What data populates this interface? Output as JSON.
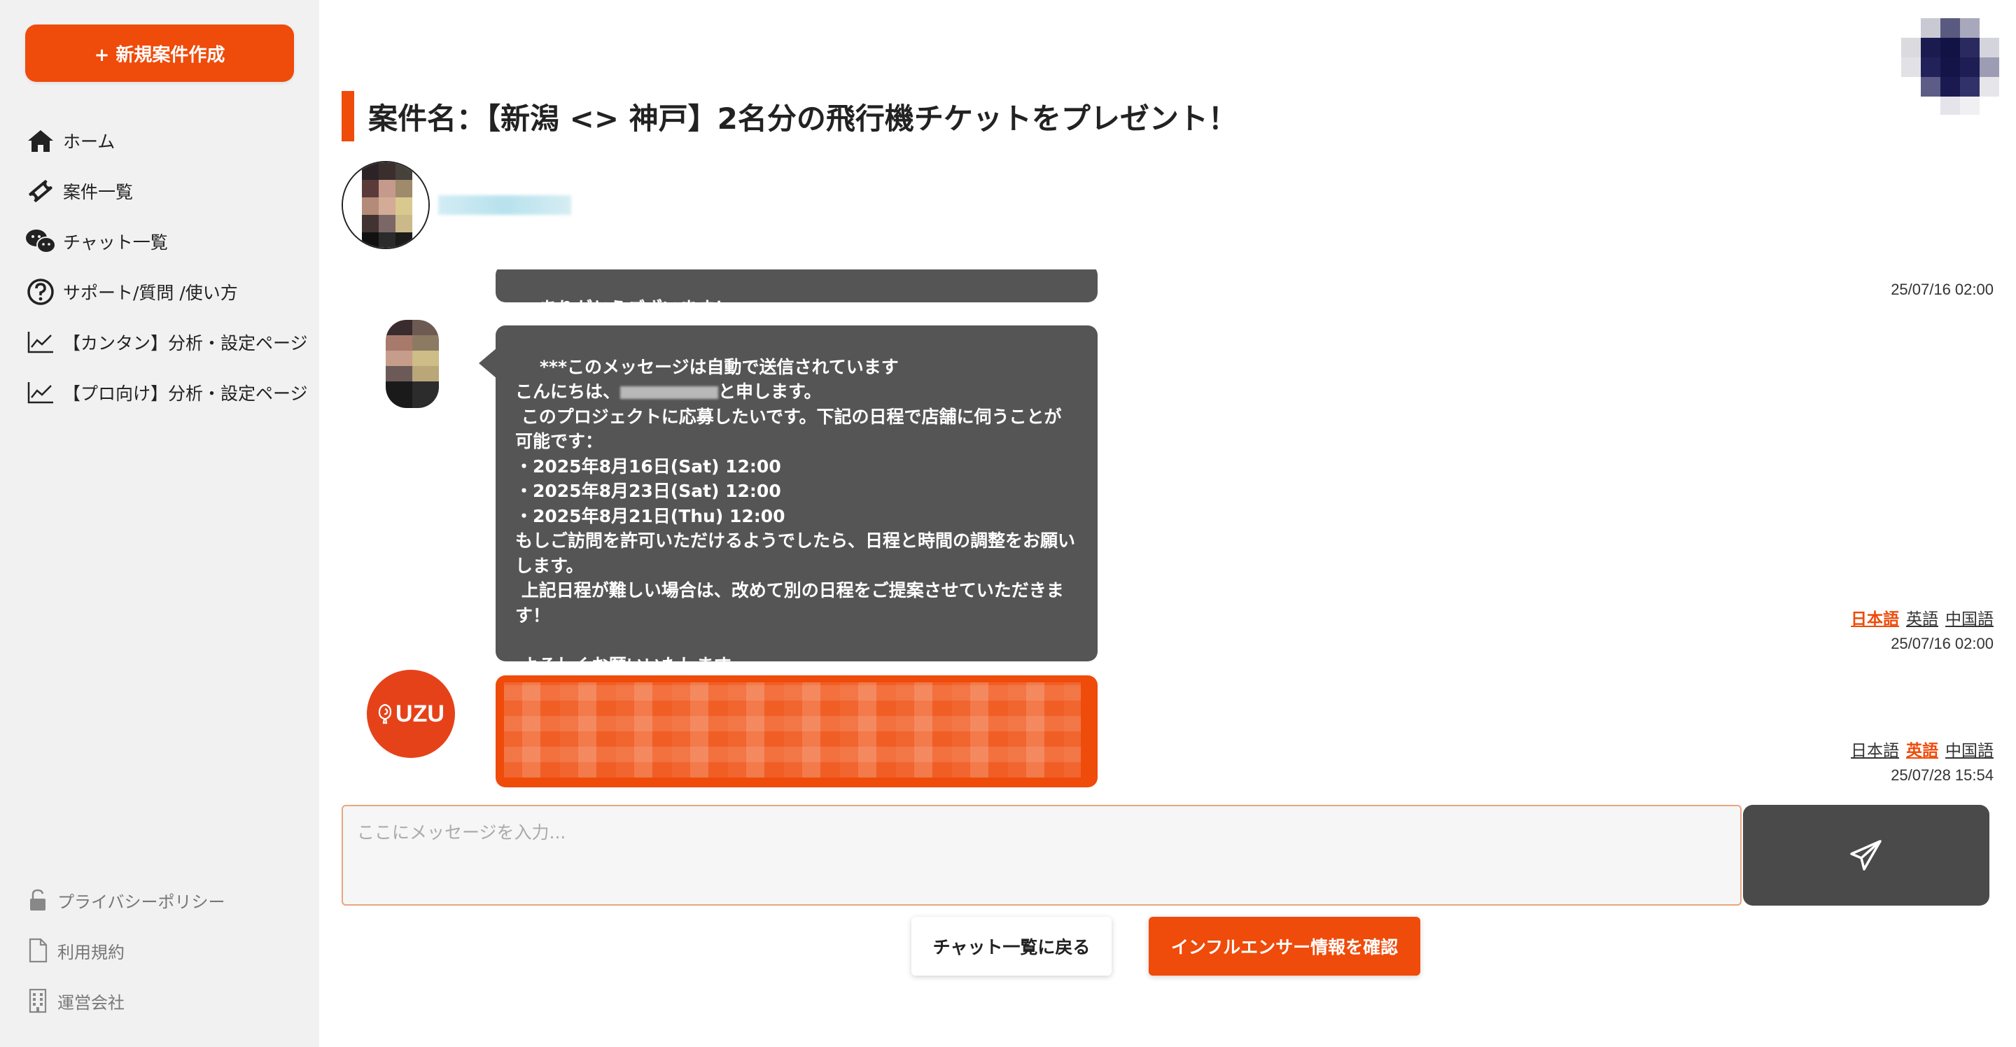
{
  "sidebar": {
    "new_button_label": "+ 新規案件作成",
    "items": [
      {
        "label": "ホーム",
        "icon": "home-icon"
      },
      {
        "label": "案件一覧",
        "icon": "ticket-icon"
      },
      {
        "label": "チャット一覧",
        "icon": "chat-bubbles-icon"
      },
      {
        "label": "サポート/質問 /使い方",
        "icon": "question-circle-icon"
      },
      {
        "label": "【カンタン】分析・設定ページ",
        "icon": "line-chart-icon"
      },
      {
        "label": "【プロ向け】分析・設定ページ",
        "icon": "line-chart-icon"
      }
    ],
    "footer": [
      {
        "label": "プライバシーポリシー",
        "icon": "lock-icon"
      },
      {
        "label": "利用規約",
        "icon": "document-icon"
      },
      {
        "label": "運営会社",
        "icon": "building-icon"
      }
    ]
  },
  "header": {
    "title": "案件名：【新潟 <> 神戸】2名分の飛行機チケットをプレゼント！"
  },
  "messages": [
    {
      "text": "ありがとうございます！",
      "timestamp": "25/07/16 02:00"
    },
    {
      "lines_before": "***このメッセージは自動で送信されています\nこんにちは、",
      "lines_after": "と申します。\n このプロジェクトに応募したいです。下記の日程で店舗に伺うことが可能です：\n・2025年8月16日(Sat) 12:00\n・2025年8月23日(Sat) 12:00\n・2025年8月21日(Thu) 12:00\nもしご訪問を許可いただけるようでしたら、日程と時間の調整をお願いします。\n 上記日程が難しい場合は、改めて別の日程をご提案させていただきます！\n\n よろしくお願いいたします。",
      "languages": [
        "日本語",
        "英語",
        "中国語"
      ],
      "active_language": "日本語",
      "timestamp": "25/07/16 02:00"
    },
    {
      "avatar_text": "UZU",
      "languages": [
        "日本語",
        "英語",
        "中国語"
      ],
      "active_language": "英語",
      "timestamp": "25/07/28 15:54"
    }
  ],
  "input": {
    "placeholder": "ここにメッセージを入力..."
  },
  "actions": {
    "back_label": "チャット一覧に戻る",
    "info_label": "インフルエンサー情報を確認"
  },
  "colors": {
    "accent": "#ef4b0b",
    "bubble_gray": "#555555",
    "send_button": "#4a4a4a"
  }
}
